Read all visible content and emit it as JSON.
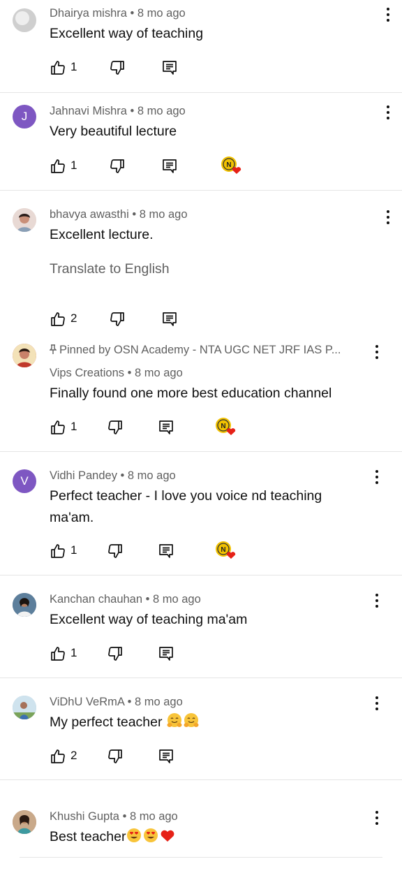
{
  "comments": [
    {
      "author": "Dhairya mishra",
      "time": "8 mo ago",
      "text": "Excellent way of teaching",
      "likes": "1",
      "avatar_letter": "",
      "avatar_color": "#d9d9d9",
      "heart": false
    },
    {
      "author": "Jahnavi Mishra",
      "time": "8 mo ago",
      "text": "Very beautiful lecture",
      "likes": "1",
      "avatar_letter": "J",
      "avatar_color": "#7e57c2",
      "heart": true
    },
    {
      "author": "bhavya awasthi",
      "time": "8 mo ago",
      "text": "Excellent lecture.",
      "translate": "Translate to English",
      "likes": "2",
      "avatar_letter": "",
      "avatar_color": "#e6d3ce",
      "heart": false
    },
    {
      "pinned": "Pinned by OSN Academy - NTA UGC NET JRF IAS P...",
      "author": "Vips Creations",
      "time": "8 mo ago",
      "text": "Finally found one more best education channel",
      "likes": "1",
      "avatar_letter": "",
      "avatar_color": "#c0392b",
      "heart": true
    },
    {
      "author": "Vidhi Pandey",
      "time": "8 mo ago",
      "text": "Perfect teacher - I love you voice nd teaching ma'am.",
      "likes": "1",
      "avatar_letter": "V",
      "avatar_color": "#7e57c2",
      "heart": true
    },
    {
      "author": "Kanchan chauhan",
      "time": "8 mo ago",
      "text": "Excellent way of teaching ma'am",
      "likes": "1",
      "avatar_letter": "",
      "avatar_color": "#3a5a7a",
      "heart": false
    },
    {
      "author": "ViDhU VeRmA",
      "time": "8 mo ago",
      "text": "My perfect teacher",
      "likes": "2",
      "avatar_letter": "",
      "avatar_color": "#8fb3c8",
      "heart": false
    },
    {
      "author": "Khushi Gupta",
      "time": "8 mo ago",
      "text": "Best teacher",
      "likes": "",
      "avatar_letter": "",
      "avatar_color": "#a6785a",
      "heart": false
    }
  ],
  "separator": " • ",
  "colors": {
    "text": "#0f0f0f",
    "secondary": "#606060",
    "divider": "#e5e5e5",
    "heart": "#e62117",
    "badge": "#f2c200"
  }
}
